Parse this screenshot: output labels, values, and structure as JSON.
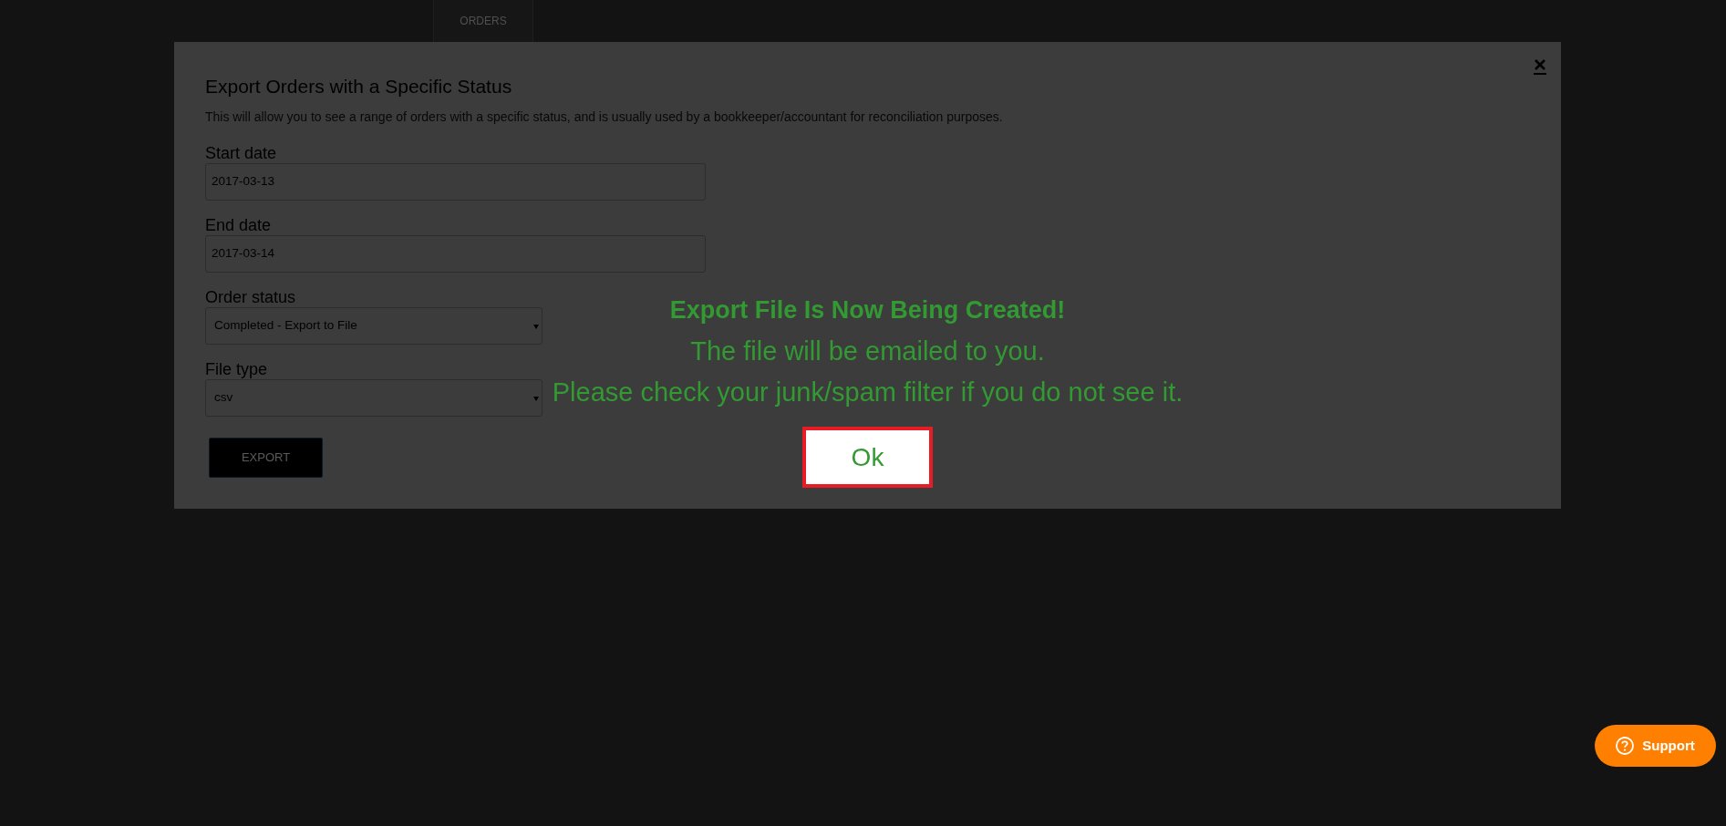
{
  "nav": {
    "tabs": [
      {
        "label": "ORDERS"
      }
    ]
  },
  "modal": {
    "title": "Export Orders with a Specific Status",
    "description": "This will allow you to see a range of orders with a specific status, and is usually used by a bookkeeper/accountant for reconciliation purposes.",
    "fields": [
      {
        "kind": "input",
        "label": "Start date",
        "value": "2017-03-13"
      },
      {
        "kind": "input",
        "label": "End date",
        "value": "2017-03-14"
      },
      {
        "kind": "select",
        "label": "Order status",
        "value": "Completed - Export to File"
      },
      {
        "kind": "select",
        "label": "File type",
        "value": "csv"
      }
    ],
    "submit_button": "EXPORT"
  },
  "notice": {
    "title": "Export File Is Now Being Created!",
    "lines": [
      "The file will be emailed to you.",
      "Please check your junk/spam filter if you do not see it."
    ],
    "button": "Ok"
  },
  "support_button": {
    "label": "Support"
  }
}
